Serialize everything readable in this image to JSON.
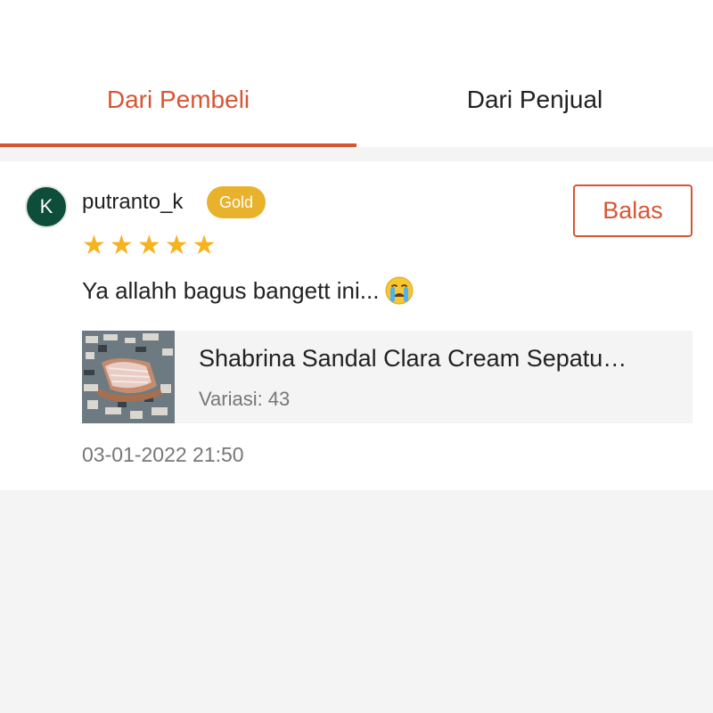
{
  "tabs": [
    {
      "label": "Dari Pembeli",
      "active": true
    },
    {
      "label": "Dari Penjual",
      "active": false
    }
  ],
  "review": {
    "avatar_initial": "K",
    "username": "putranto_k",
    "badge": "Gold",
    "rating": 5,
    "reply_label": "Balas",
    "text": "Ya allahh bagus bangett ini...",
    "emoji": "loudly-crying-face",
    "product": {
      "name": "Shabrina Sandal Clara Cream Sepatu…",
      "variant_label": "Variasi:",
      "variant_value": "43"
    },
    "date": "03-01-2022 21:50"
  },
  "colors": {
    "accent": "#d65633",
    "badge": "#e8b22c",
    "star": "#f6b320",
    "avatar_bg": "#0e4d3a"
  }
}
